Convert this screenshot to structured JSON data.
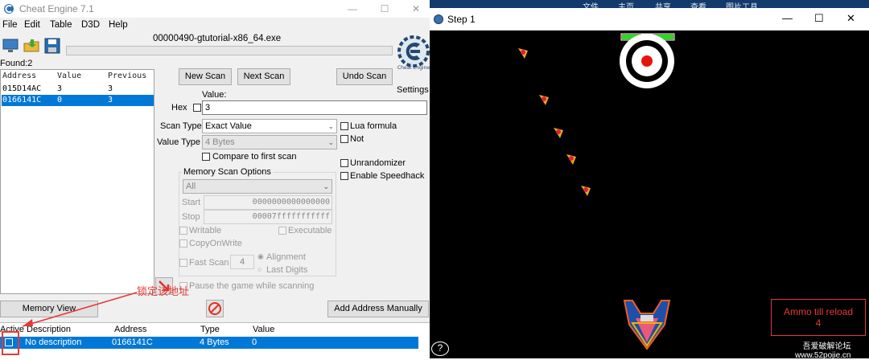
{
  "cheat_engine": {
    "title": "Cheat Engine 7.1",
    "menu": [
      "File",
      "Edit",
      "Table",
      "D3D",
      "Help"
    ],
    "process": "00000490-gtutorial-x86_64.exe",
    "found_label": "Found:2",
    "results": {
      "columns": [
        "Address",
        "Value",
        "Previous"
      ],
      "rows": [
        {
          "address": "015D14AC",
          "value": "3",
          "previous": "3"
        },
        {
          "address": "0166141C",
          "value": "0",
          "previous": "3"
        }
      ]
    },
    "buttons": {
      "new_scan": "New Scan",
      "next_scan": "Next Scan",
      "undo_scan": "Undo Scan",
      "settings": "Settings",
      "memory_view": "Memory View",
      "add_address": "Add Address Manually"
    },
    "value_label": "Value:",
    "hex_label": "Hex",
    "value_input": "3",
    "scan_type_label": "Scan Type",
    "scan_type_value": "Exact Value",
    "value_type_label": "Value Type",
    "value_type_value": "4 Bytes",
    "compare_first": "Compare to first scan",
    "right_options": {
      "lua_formula": "Lua formula",
      "not": "Not",
      "unrandomizer": "Unrandomizer",
      "speedhack": "Enable Speedhack"
    },
    "mem_scan": {
      "title": "Memory Scan Options",
      "region": "All",
      "start_label": "Start",
      "start_value": "0000000000000000",
      "stop_label": "Stop",
      "stop_value": "00007fffffffffff",
      "writable": "Writable",
      "executable": "Executable",
      "copyonwrite": "CopyOnWrite",
      "fast_scan": "Fast Scan",
      "fast_scan_value": "4",
      "alignment": "Alignment",
      "last_digits": "Last Digits",
      "pause_game": "Pause the game while scanning"
    },
    "address_list": {
      "columns": [
        "Active",
        "Description",
        "Address",
        "Type",
        "Value"
      ],
      "row": {
        "description": "No description",
        "address": "0166141C",
        "type": "4 Bytes",
        "value": "0"
      }
    },
    "logo_caption": "Cheat Engine"
  },
  "annotation": {
    "text": "锁定该地址",
    "color": "#e53935"
  },
  "background_window": {
    "tabs": [
      "文件",
      "主页",
      "共享",
      "查看",
      "图片工具"
    ]
  },
  "game": {
    "title": "Step 1",
    "ammo_label": "Ammo till reload",
    "ammo_value": "4",
    "watermark_line1": "吾爱破解论坛",
    "watermark_line2": "www.52pojie.cn",
    "help": "?",
    "target_health": 1.0
  },
  "colors": {
    "selection": "#0078d7",
    "health_bar": "#22dd22",
    "target_red": "#e8140c",
    "annotation_red": "#e53935"
  }
}
